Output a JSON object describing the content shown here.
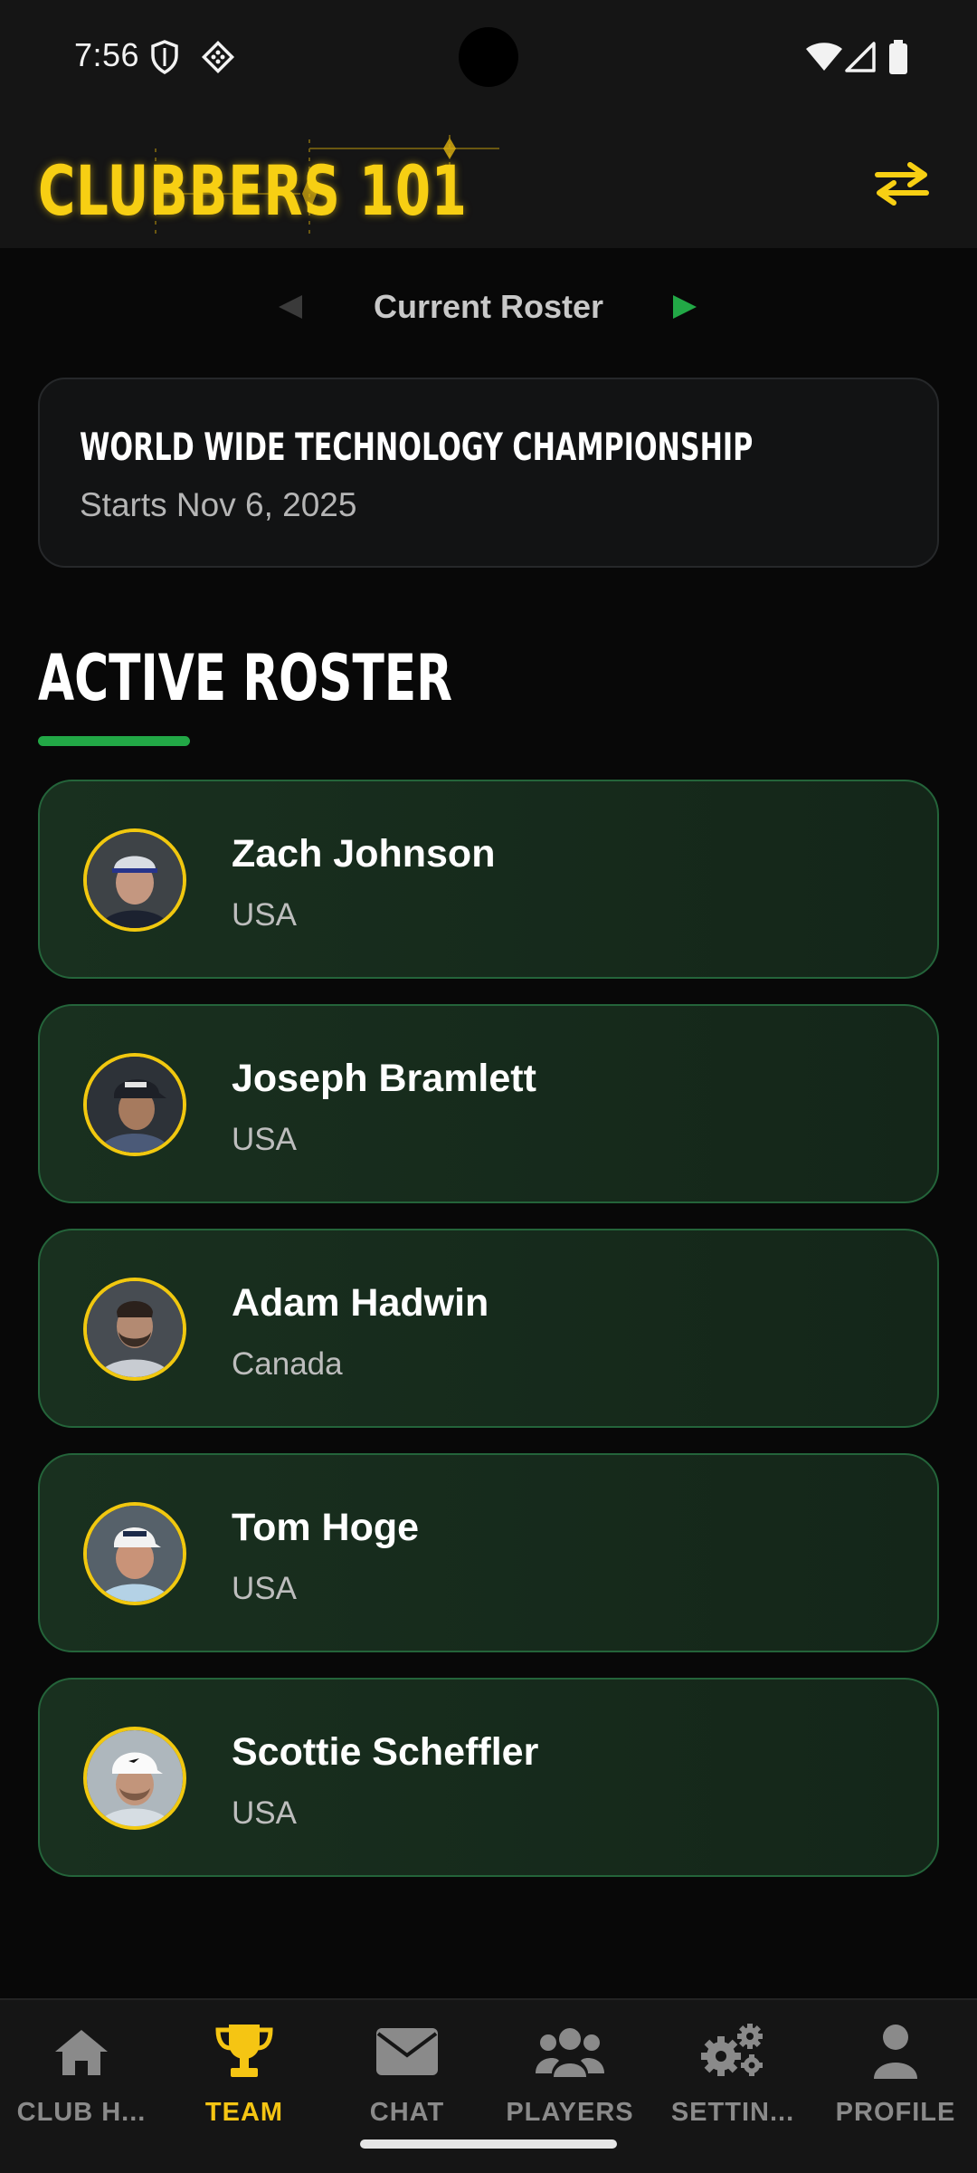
{
  "status_bar": {
    "time": "7:56",
    "icons": [
      "shield-icon",
      "app-notification-icon",
      "wifi-icon",
      "signal-icon",
      "battery-icon"
    ]
  },
  "header": {
    "logo_text": "CLUBBERS 101",
    "logo_color": "#f7cf13",
    "swap_icon": "swap-arrows-icon"
  },
  "roster_nav": {
    "label": "Current Roster",
    "prev_icon": "triangle-left-icon",
    "next_icon": "triangle-right-icon"
  },
  "tournament": {
    "name": "WORLD WIDE TECHNOLOGY CHAMPIONSHIP",
    "date": "Starts Nov 6, 2025"
  },
  "section": {
    "title": "ACTIVE ROSTER",
    "accent_color": "#22a846"
  },
  "players": [
    {
      "name": "Zach Johnson",
      "country": "USA"
    },
    {
      "name": "Joseph Bramlett",
      "country": "USA"
    },
    {
      "name": "Adam Hadwin",
      "country": "Canada"
    },
    {
      "name": "Tom Hoge",
      "country": "USA"
    },
    {
      "name": "Scottie Scheffler",
      "country": "USA"
    }
  ],
  "bottom_nav": {
    "active_color": "#f5c513",
    "tabs": [
      {
        "label": "CLUB H...",
        "icon": "home-icon",
        "active": false
      },
      {
        "label": "TEAM",
        "icon": "trophy-icon",
        "active": true
      },
      {
        "label": "CHAT",
        "icon": "envelope-icon",
        "active": false
      },
      {
        "label": "PLAYERS",
        "icon": "users-icon",
        "active": false
      },
      {
        "label": "SETTIN...",
        "icon": "gears-icon",
        "active": false
      },
      {
        "label": "PROFILE",
        "icon": "user-icon",
        "active": false
      }
    ]
  }
}
